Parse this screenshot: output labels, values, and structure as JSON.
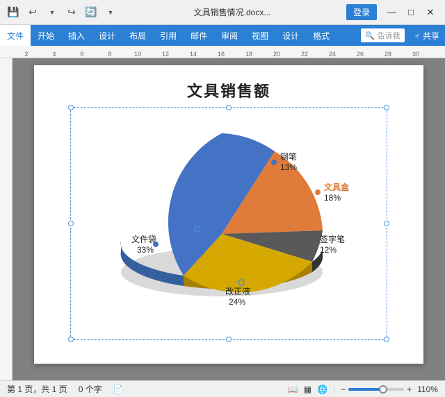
{
  "titleBar": {
    "filename": "文具销售情况.docx...",
    "loginLabel": "登录"
  },
  "ribbon": {
    "tabs": [
      "文件",
      "开始",
      "插入",
      "设计",
      "布局",
      "引用",
      "邮件",
      "审阅",
      "视图",
      "设计",
      "格式"
    ],
    "searchPlaceholder": "告诉我",
    "shareLabel": "♂共享"
  },
  "chart": {
    "title": "文具销售额",
    "segments": [
      {
        "label": "钢笔",
        "percent": "13%",
        "color": "#4472c4",
        "dotColor": "#4472c4"
      },
      {
        "label": "文具盒",
        "percent": "18%",
        "color": "#e07b39",
        "dotColor": "#e07b39"
      },
      {
        "label": "签字笔",
        "percent": "12%",
        "color": "#595959",
        "dotColor": "#595959"
      },
      {
        "label": "改正液",
        "percent": "24%",
        "color": "#d4a800",
        "dotColor": "#d4a800"
      },
      {
        "label": "文件袋",
        "percent": "33%",
        "color": "#4472c4",
        "dotColor": "#4472c4"
      }
    ]
  },
  "statusBar": {
    "pageInfo": "第 1 页，共 1 页",
    "wordCount": "0 个字",
    "zoomLevel": "110%",
    "viewIcons": [
      "📄",
      "▦",
      "👁"
    ]
  },
  "windowControls": {
    "minimize": "—",
    "maximize": "□",
    "close": "✕"
  }
}
